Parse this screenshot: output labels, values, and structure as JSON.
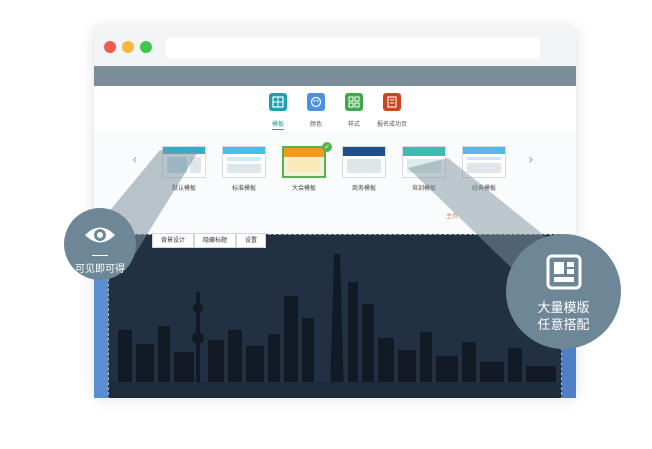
{
  "toolbar": {
    "items": [
      {
        "label": "模板",
        "icon": "template-grid-icon",
        "color": "#1aa0ae",
        "active": true
      },
      {
        "label": "颜色",
        "icon": "palette-icon",
        "color": "#4d8fe0",
        "active": false
      },
      {
        "label": "样式",
        "icon": "style-blocks-icon",
        "color": "#3fa84a",
        "active": false
      },
      {
        "label": "报名成功页",
        "icon": "success-page-icon",
        "color": "#c9461f",
        "active": false
      }
    ]
  },
  "templates": [
    {
      "label": "默认模板",
      "accent": "#2bb0c9"
    },
    {
      "label": "标准模板",
      "accent": "#49c0e3"
    },
    {
      "label": "大会模板",
      "accent": "#f29a1f",
      "selected": true
    },
    {
      "label": "商务模板",
      "accent": "#1f4f8a"
    },
    {
      "label": "培训模板",
      "accent": "#3cbcb0"
    },
    {
      "label": "经典模板",
      "accent": "#58b7e6"
    }
  ],
  "nav": {
    "prev": "‹",
    "next": "›",
    "home": "主页"
  },
  "editbar": {
    "buttons": [
      "背景设计",
      "隐藏标题",
      "设置"
    ]
  },
  "badges": {
    "left": {
      "caption": "可见即可得",
      "icon": "eye-icon"
    },
    "right": {
      "line1": "大量模版",
      "line2": "任意搭配",
      "icon": "layout-icon"
    }
  }
}
